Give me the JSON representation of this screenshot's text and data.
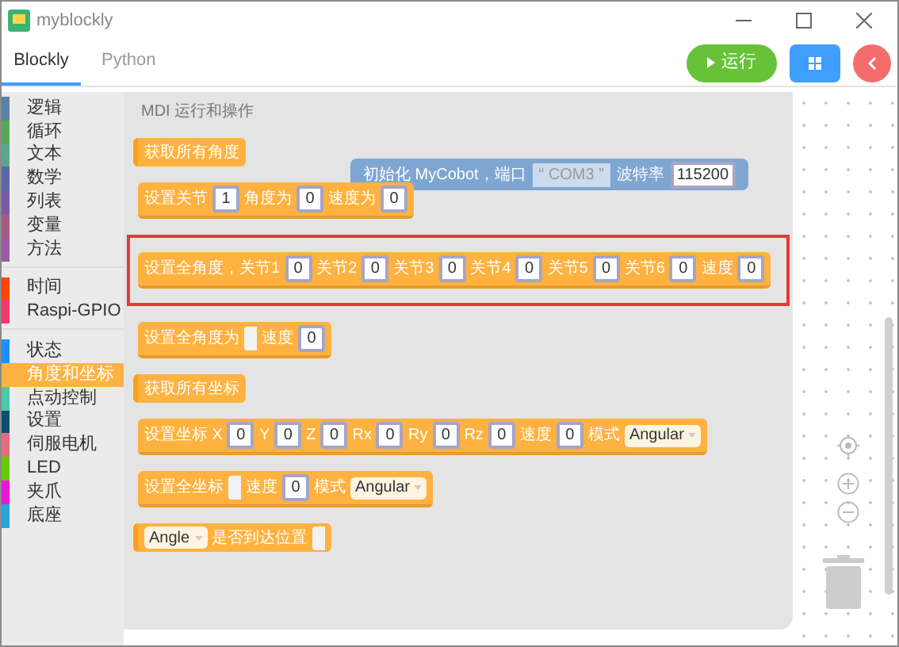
{
  "window": {
    "title": "myblockly"
  },
  "tabs": [
    {
      "label": "Blockly",
      "selected": true
    },
    {
      "label": "Python",
      "selected": false
    }
  ],
  "run_button": {
    "label": "运行"
  },
  "category_groups": [
    [
      {
        "label": "逻辑",
        "color": "#5b80a5",
        "selected": false
      },
      {
        "label": "循环",
        "color": "#5ba55b",
        "selected": false
      },
      {
        "label": "文本",
        "color": "#5ba58c",
        "selected": false
      },
      {
        "label": "数学",
        "color": "#5b67a5",
        "selected": false
      },
      {
        "label": "列表",
        "color": "#745ba5",
        "selected": false
      },
      {
        "label": "变量",
        "color": "#a55b80",
        "selected": false
      },
      {
        "label": "方法",
        "color": "#995ba5",
        "selected": false
      }
    ],
    [
      {
        "label": "时间",
        "color": "#ff4500",
        "selected": false
      },
      {
        "label": "Raspi-GPIO",
        "color": "#f0396e",
        "selected": false
      }
    ],
    [
      {
        "label": "状态",
        "color": "#1e90ff",
        "selected": false
      },
      {
        "label": "角度和坐标",
        "color": "#ffb23f",
        "selected": true
      },
      {
        "label": "点动控制",
        "color": "#48c9b0",
        "selected": false
      },
      {
        "label": "设置",
        "color": "#0b4f6c",
        "selected": false
      },
      {
        "label": "伺服电机",
        "color": "#e56b7e",
        "selected": false
      },
      {
        "label": "LED",
        "color": "#66cc00",
        "selected": false
      },
      {
        "label": "夹爪",
        "color": "#e916d6",
        "selected": false
      },
      {
        "label": "底座",
        "color": "#2aa2dc",
        "selected": false
      }
    ]
  ],
  "flyout": {
    "title": "MDI 运行和操作",
    "ghost_block": {
      "parts": [
        {
          "kind": "text",
          "text": "初始化 MyCobot，端口"
        },
        {
          "kind": "string",
          "text": "COM3",
          "quote_open": "“",
          "quote_close": "”"
        },
        {
          "kind": "text",
          "text": "波特率"
        },
        {
          "kind": "number",
          "text": "115200"
        }
      ]
    },
    "blocks": [
      {
        "kind": "value",
        "highlighted": false,
        "parts": [
          {
            "kind": "text",
            "text": "获取所有角度"
          }
        ]
      },
      {
        "kind": "statement",
        "highlighted": false,
        "parts": [
          {
            "kind": "text",
            "text": "设置关节"
          },
          {
            "kind": "number",
            "text": "1"
          },
          {
            "kind": "text",
            "text": "角度为"
          },
          {
            "kind": "number",
            "text": "0"
          },
          {
            "kind": "text",
            "text": "速度为"
          },
          {
            "kind": "number",
            "text": "0"
          }
        ]
      },
      {
        "kind": "statement",
        "highlighted": true,
        "parts": [
          {
            "kind": "text",
            "text": "设置全角度，关节1"
          },
          {
            "kind": "number",
            "text": "0"
          },
          {
            "kind": "text",
            "text": "关节2"
          },
          {
            "kind": "number",
            "text": "0"
          },
          {
            "kind": "text",
            "text": "关节3"
          },
          {
            "kind": "number",
            "text": "0"
          },
          {
            "kind": "text",
            "text": "关节4"
          },
          {
            "kind": "number",
            "text": "0"
          },
          {
            "kind": "text",
            "text": "关节5"
          },
          {
            "kind": "number",
            "text": "0"
          },
          {
            "kind": "text",
            "text": "关节6"
          },
          {
            "kind": "number",
            "text": "0"
          },
          {
            "kind": "text",
            "text": "速度"
          },
          {
            "kind": "number",
            "text": "0"
          }
        ]
      },
      {
        "kind": "statement",
        "highlighted": false,
        "parts": [
          {
            "kind": "text",
            "text": "设置全角度为"
          },
          {
            "kind": "socket"
          },
          {
            "kind": "text",
            "text": "速度"
          },
          {
            "kind": "number",
            "text": "0"
          }
        ]
      },
      {
        "kind": "value",
        "highlighted": false,
        "parts": [
          {
            "kind": "text",
            "text": "获取所有坐标"
          }
        ]
      },
      {
        "kind": "statement",
        "highlighted": false,
        "parts": [
          {
            "kind": "text",
            "text": "设置坐标 X"
          },
          {
            "kind": "number",
            "text": "0"
          },
          {
            "kind": "text",
            "text": "Y"
          },
          {
            "kind": "number",
            "text": "0"
          },
          {
            "kind": "text",
            "text": "Z"
          },
          {
            "kind": "number",
            "text": "0"
          },
          {
            "kind": "text",
            "text": "Rx"
          },
          {
            "kind": "number",
            "text": "0"
          },
          {
            "kind": "text",
            "text": "Ry"
          },
          {
            "kind": "number",
            "text": "0"
          },
          {
            "kind": "text",
            "text": "Rz"
          },
          {
            "kind": "number",
            "text": "0"
          },
          {
            "kind": "text",
            "text": "速度"
          },
          {
            "kind": "number",
            "text": "0"
          },
          {
            "kind": "text",
            "text": "模式"
          },
          {
            "kind": "dropdown",
            "text": "Angular"
          }
        ]
      },
      {
        "kind": "statement",
        "highlighted": false,
        "parts": [
          {
            "kind": "text",
            "text": "设置全坐标"
          },
          {
            "kind": "socket"
          },
          {
            "kind": "text",
            "text": "速度"
          },
          {
            "kind": "number",
            "text": "0"
          },
          {
            "kind": "text",
            "text": "模式"
          },
          {
            "kind": "dropdown",
            "text": "Angular"
          }
        ]
      },
      {
        "kind": "value",
        "highlighted": false,
        "parts": [
          {
            "kind": "dropdown",
            "text": "Angle"
          },
          {
            "kind": "text",
            "text": "是否到达位置"
          },
          {
            "kind": "socket"
          }
        ]
      }
    ]
  }
}
